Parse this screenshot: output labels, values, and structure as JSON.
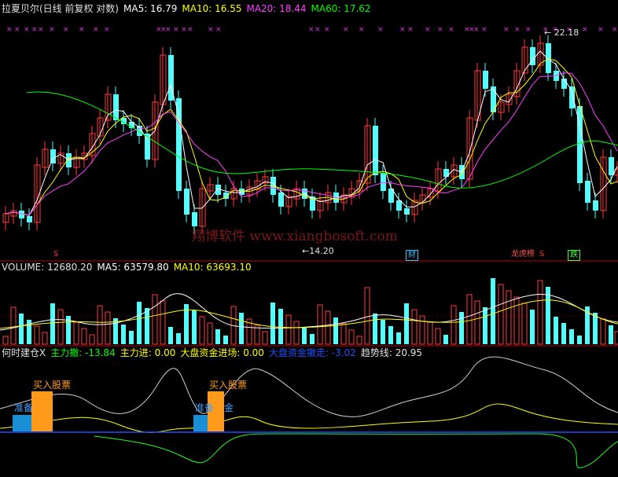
{
  "price_panel": {
    "title": "拉夏贝尔(日线 前复权 对数)",
    "ma5": "MA5: 16.79",
    "ma10": "MA10: 16.55",
    "ma20": "MA20: 18.44",
    "ma60": "MA60: 17.62",
    "high_label": "22.18",
    "low_label": "14.20",
    "watermark": "翔博软件 www.xiangbosoft.com",
    "marks": [
      {
        "text": "S",
        "color": "#ff3030"
      },
      {
        "text": "财",
        "color": "#40c0ff"
      },
      {
        "text": "龙虎榜",
        "color": "#ff5050"
      },
      {
        "text": "S",
        "color": "#ff3030"
      },
      {
        "text": "跌",
        "color": "#40ff40"
      }
    ]
  },
  "volume_panel": {
    "volume": "VOLUME: 12680.20",
    "ma5": "MA5: 63579.80",
    "ma10": "MA10: 63693.10"
  },
  "indicator_panel": {
    "title": "何时建仓X",
    "main_withdraw": "主力撤: -13.84",
    "main_enter": "主力进: 0.00",
    "market_enter": "大盘资金进场: 0.00",
    "market_withdraw": "大盘资金撤走: -3.02",
    "trend_line": "趋势线: 20.95",
    "signals": [
      {
        "prepare": "准备",
        "buy": "买入股票"
      },
      {
        "prepare": "准备",
        "buy": "买入股票",
        "tail": "金"
      }
    ]
  },
  "colors": {
    "up": "#ff3b3b",
    "down": "#54fcfc",
    "ma5": "#ffffff",
    "ma10": "#ffff00",
    "ma20": "#ff40ff",
    "ma60": "#00ff00",
    "frame": "#c00000",
    "signal_blue": "#1a8fd6",
    "signal_orange": "#ff9a1a"
  }
}
